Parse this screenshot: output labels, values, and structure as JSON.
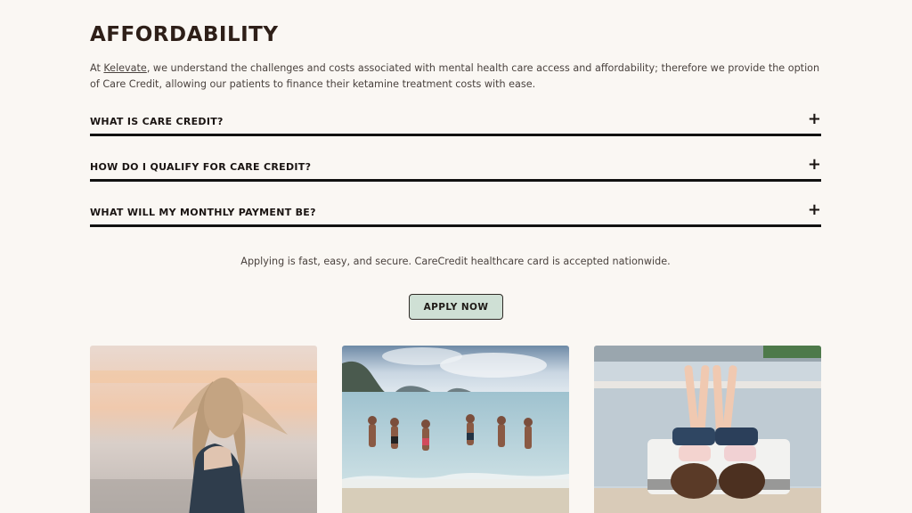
{
  "section": {
    "title": "AFFORDABILITY",
    "intro_prefix": "At ",
    "intro_link": "Kelevate",
    "intro_suffix": ", we understand the challenges and costs associated with mental health care access and affordability; therefore we provide the option of Care Credit, allowing our patients to finance their ketamine treatment costs with ease."
  },
  "faq": [
    {
      "question": "WHAT IS CARE CREDIT?",
      "icon": "+"
    },
    {
      "question": "HOW DO I QUALIFY FOR CARE CREDIT?",
      "icon": "+"
    },
    {
      "question": "WHAT WILL MY MONTHLY PAYMENT BE?",
      "icon": "+"
    }
  ],
  "note": "Applying is fast, easy, and secure. CareCredit healthcare card is accepted nationwide.",
  "apply_button": {
    "label": "APPLY NOW",
    "color": "#cfe0d5"
  },
  "photos": [
    {
      "icon": "woman-hair-photo"
    },
    {
      "icon": "beach-people-photo"
    },
    {
      "icon": "women-lying-photo"
    }
  ]
}
